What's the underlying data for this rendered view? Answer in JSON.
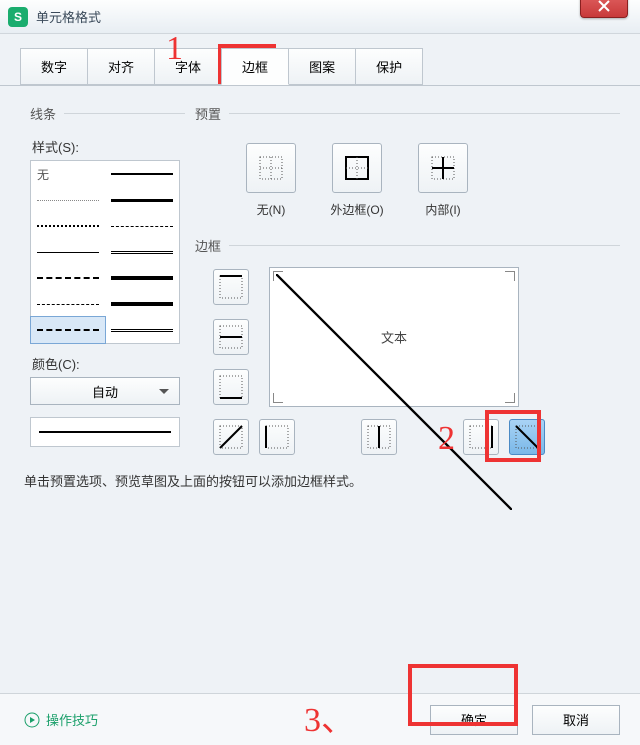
{
  "window": {
    "title": "单元格格式"
  },
  "tabs": {
    "t1": "数字",
    "t2": "对齐",
    "t3": "字体",
    "t4": "边框",
    "t5": "图案",
    "t6": "保护",
    "active": "t4"
  },
  "groups": {
    "lines": "线条",
    "style": "样式(S):",
    "none": "无",
    "color": "颜色(C):",
    "auto": "自动",
    "preset": "预置",
    "border": "边框"
  },
  "presets": {
    "none": "无(N)",
    "outer": "外边框(O)",
    "inner": "内部(I)"
  },
  "preview": {
    "text": "文本"
  },
  "hint": "单击预置选项、预览草图及上面的按钮可以添加边框样式。",
  "footer": {
    "help": "操作技巧",
    "ok": "确定",
    "cancel": "取消"
  },
  "annotations": {
    "a1": "1",
    "a2": "2",
    "a3": "3、"
  }
}
